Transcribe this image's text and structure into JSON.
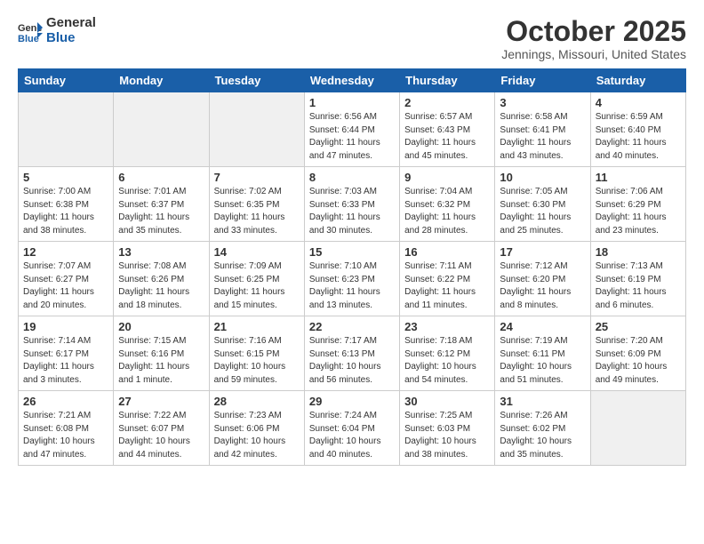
{
  "header": {
    "logo_general": "General",
    "logo_blue": "Blue",
    "month": "October 2025",
    "location": "Jennings, Missouri, United States"
  },
  "weekdays": [
    "Sunday",
    "Monday",
    "Tuesday",
    "Wednesday",
    "Thursday",
    "Friday",
    "Saturday"
  ],
  "weeks": [
    [
      {
        "day": "",
        "info": ""
      },
      {
        "day": "",
        "info": ""
      },
      {
        "day": "",
        "info": ""
      },
      {
        "day": "1",
        "info": "Sunrise: 6:56 AM\nSunset: 6:44 PM\nDaylight: 11 hours\nand 47 minutes."
      },
      {
        "day": "2",
        "info": "Sunrise: 6:57 AM\nSunset: 6:43 PM\nDaylight: 11 hours\nand 45 minutes."
      },
      {
        "day": "3",
        "info": "Sunrise: 6:58 AM\nSunset: 6:41 PM\nDaylight: 11 hours\nand 43 minutes."
      },
      {
        "day": "4",
        "info": "Sunrise: 6:59 AM\nSunset: 6:40 PM\nDaylight: 11 hours\nand 40 minutes."
      }
    ],
    [
      {
        "day": "5",
        "info": "Sunrise: 7:00 AM\nSunset: 6:38 PM\nDaylight: 11 hours\nand 38 minutes."
      },
      {
        "day": "6",
        "info": "Sunrise: 7:01 AM\nSunset: 6:37 PM\nDaylight: 11 hours\nand 35 minutes."
      },
      {
        "day": "7",
        "info": "Sunrise: 7:02 AM\nSunset: 6:35 PM\nDaylight: 11 hours\nand 33 minutes."
      },
      {
        "day": "8",
        "info": "Sunrise: 7:03 AM\nSunset: 6:33 PM\nDaylight: 11 hours\nand 30 minutes."
      },
      {
        "day": "9",
        "info": "Sunrise: 7:04 AM\nSunset: 6:32 PM\nDaylight: 11 hours\nand 28 minutes."
      },
      {
        "day": "10",
        "info": "Sunrise: 7:05 AM\nSunset: 6:30 PM\nDaylight: 11 hours\nand 25 minutes."
      },
      {
        "day": "11",
        "info": "Sunrise: 7:06 AM\nSunset: 6:29 PM\nDaylight: 11 hours\nand 23 minutes."
      }
    ],
    [
      {
        "day": "12",
        "info": "Sunrise: 7:07 AM\nSunset: 6:27 PM\nDaylight: 11 hours\nand 20 minutes."
      },
      {
        "day": "13",
        "info": "Sunrise: 7:08 AM\nSunset: 6:26 PM\nDaylight: 11 hours\nand 18 minutes."
      },
      {
        "day": "14",
        "info": "Sunrise: 7:09 AM\nSunset: 6:25 PM\nDaylight: 11 hours\nand 15 minutes."
      },
      {
        "day": "15",
        "info": "Sunrise: 7:10 AM\nSunset: 6:23 PM\nDaylight: 11 hours\nand 13 minutes."
      },
      {
        "day": "16",
        "info": "Sunrise: 7:11 AM\nSunset: 6:22 PM\nDaylight: 11 hours\nand 11 minutes."
      },
      {
        "day": "17",
        "info": "Sunrise: 7:12 AM\nSunset: 6:20 PM\nDaylight: 11 hours\nand 8 minutes."
      },
      {
        "day": "18",
        "info": "Sunrise: 7:13 AM\nSunset: 6:19 PM\nDaylight: 11 hours\nand 6 minutes."
      }
    ],
    [
      {
        "day": "19",
        "info": "Sunrise: 7:14 AM\nSunset: 6:17 PM\nDaylight: 11 hours\nand 3 minutes."
      },
      {
        "day": "20",
        "info": "Sunrise: 7:15 AM\nSunset: 6:16 PM\nDaylight: 11 hours\nand 1 minute."
      },
      {
        "day": "21",
        "info": "Sunrise: 7:16 AM\nSunset: 6:15 PM\nDaylight: 10 hours\nand 59 minutes."
      },
      {
        "day": "22",
        "info": "Sunrise: 7:17 AM\nSunset: 6:13 PM\nDaylight: 10 hours\nand 56 minutes."
      },
      {
        "day": "23",
        "info": "Sunrise: 7:18 AM\nSunset: 6:12 PM\nDaylight: 10 hours\nand 54 minutes."
      },
      {
        "day": "24",
        "info": "Sunrise: 7:19 AM\nSunset: 6:11 PM\nDaylight: 10 hours\nand 51 minutes."
      },
      {
        "day": "25",
        "info": "Sunrise: 7:20 AM\nSunset: 6:09 PM\nDaylight: 10 hours\nand 49 minutes."
      }
    ],
    [
      {
        "day": "26",
        "info": "Sunrise: 7:21 AM\nSunset: 6:08 PM\nDaylight: 10 hours\nand 47 minutes."
      },
      {
        "day": "27",
        "info": "Sunrise: 7:22 AM\nSunset: 6:07 PM\nDaylight: 10 hours\nand 44 minutes."
      },
      {
        "day": "28",
        "info": "Sunrise: 7:23 AM\nSunset: 6:06 PM\nDaylight: 10 hours\nand 42 minutes."
      },
      {
        "day": "29",
        "info": "Sunrise: 7:24 AM\nSunset: 6:04 PM\nDaylight: 10 hours\nand 40 minutes."
      },
      {
        "day": "30",
        "info": "Sunrise: 7:25 AM\nSunset: 6:03 PM\nDaylight: 10 hours\nand 38 minutes."
      },
      {
        "day": "31",
        "info": "Sunrise: 7:26 AM\nSunset: 6:02 PM\nDaylight: 10 hours\nand 35 minutes."
      },
      {
        "day": "",
        "info": ""
      }
    ]
  ]
}
